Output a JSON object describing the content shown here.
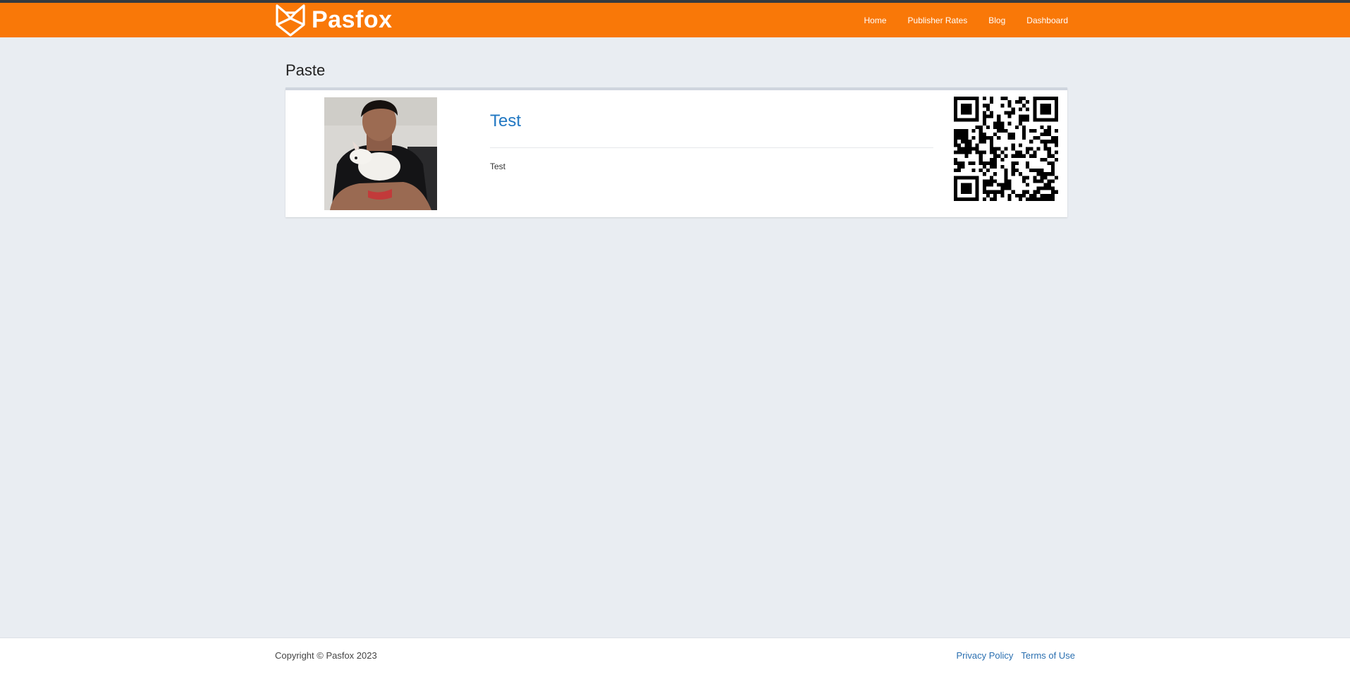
{
  "brand": {
    "name": "Pasfox",
    "logo_icon": "fox-head-icon"
  },
  "nav": {
    "items": [
      {
        "label": "Home"
      },
      {
        "label": "Publisher Rates"
      },
      {
        "label": "Blog"
      },
      {
        "label": "Dashboard"
      }
    ]
  },
  "page": {
    "title": "Paste"
  },
  "paste": {
    "title": "Test",
    "body": "Test",
    "avatar_icon": "user-avatar-photo",
    "qr_icon": "qr-code-icon"
  },
  "footer": {
    "copyright": "Copyright © Pasfox 2023",
    "links": [
      {
        "label": "Privacy Policy"
      },
      {
        "label": "Terms of Use"
      }
    ]
  },
  "colors": {
    "brand_orange": "#f97808",
    "page_background": "#e9edf2",
    "link_blue": "#2077c2"
  }
}
